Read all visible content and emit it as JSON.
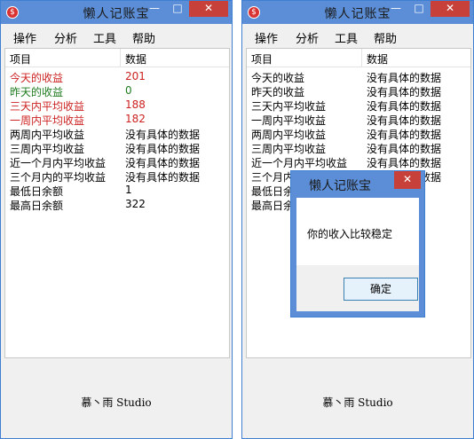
{
  "app": {
    "title": "懒人记账宝",
    "icon_glyph": "$",
    "minimize_glyph": "—",
    "maximize_glyph": "□",
    "close_glyph": "✕"
  },
  "menu": [
    "操作",
    "分析",
    "工具",
    "帮助"
  ],
  "table": {
    "headers": [
      "项目",
      "数据"
    ],
    "left_rows": [
      {
        "label": "今天的收益",
        "value": "201",
        "color": "#cc2222"
      },
      {
        "label": "昨天的收益",
        "value": "0",
        "color": "#1f7a1f"
      },
      {
        "label": "三天内平均收益",
        "value": "188",
        "color": "#cc2222"
      },
      {
        "label": "一周内平均收益",
        "value": "182",
        "color": "#cc2222"
      },
      {
        "label": "两周内平均收益",
        "value": "没有具体的数据"
      },
      {
        "label": "三周内平均收益",
        "value": "没有具体的数据"
      },
      {
        "label": "近一个月内平均收益",
        "value": "没有具体的数据"
      },
      {
        "label": "三个月内的平均收益",
        "value": "没有具体的数据"
      },
      {
        "label": "最低日余额",
        "value": "1"
      },
      {
        "label": "最高日余额",
        "value": "322"
      }
    ],
    "right_rows": [
      {
        "label": "今天的收益",
        "value": "没有具体的数据"
      },
      {
        "label": "昨天的收益",
        "value": "没有具体的数据"
      },
      {
        "label": "三天内平均收益",
        "value": "没有具体的数据"
      },
      {
        "label": "一周内平均收益",
        "value": "没有具体的数据"
      },
      {
        "label": "两周内平均收益",
        "value": "没有具体的数据"
      },
      {
        "label": "三周内平均收益",
        "value": "没有具体的数据"
      },
      {
        "label": "近一个月内平均收益",
        "value": "没有具体的数据"
      },
      {
        "label": "三个月内",
        "value": "没有具体的数据"
      },
      {
        "label": "最低日余",
        "value": ""
      },
      {
        "label": "最高日余",
        "value": ""
      }
    ]
  },
  "footer": {
    "text": "慕丶雨 Studio"
  },
  "dialog": {
    "title": "懒人记账宝",
    "message": "你的收入比较稳定",
    "ok_label": "确定",
    "close_glyph": "✕"
  }
}
